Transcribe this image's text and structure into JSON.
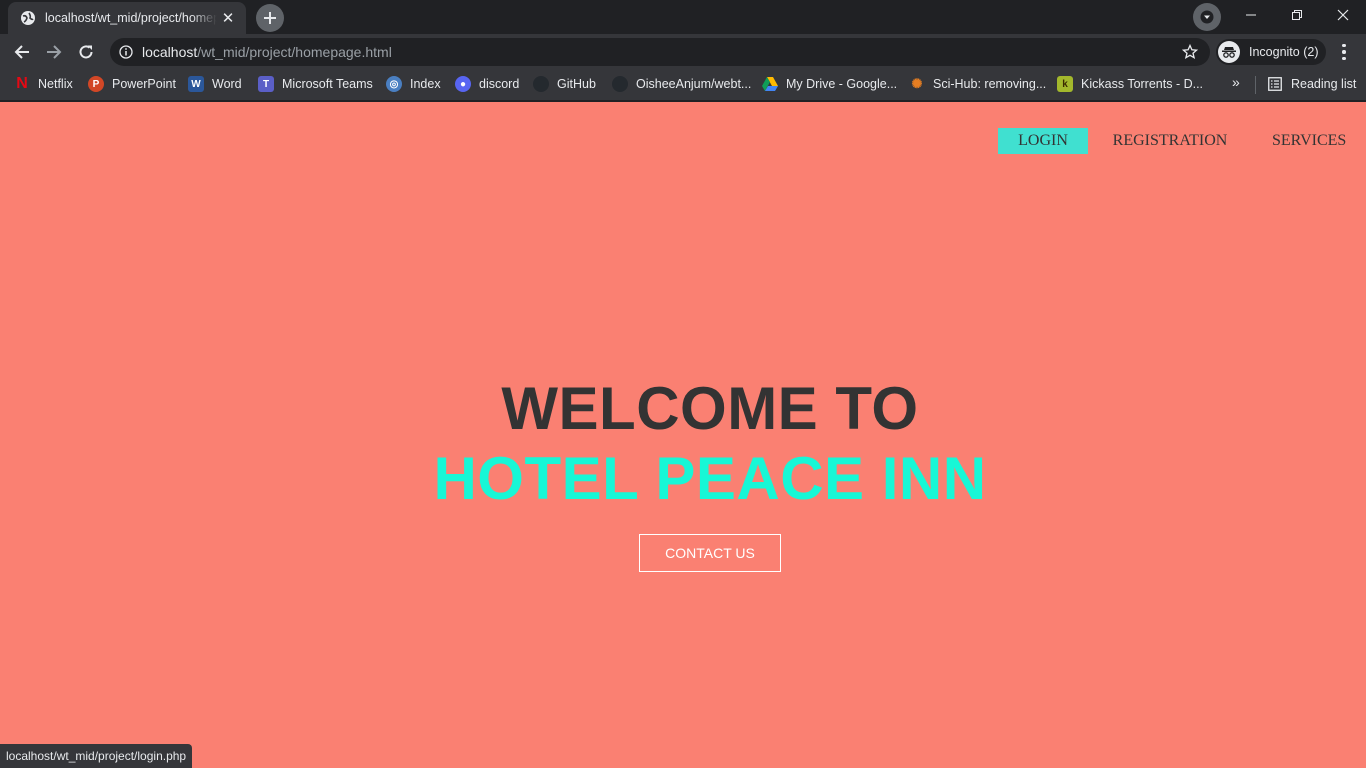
{
  "tab": {
    "title": "localhost/wt_mid/project/homepage.html",
    "favicon": "globe-icon"
  },
  "address_bar": {
    "host": "localhost",
    "path": "/wt_mid/project/homepage.html"
  },
  "incognito": {
    "label": "Incognito (2)"
  },
  "bookmarks": [
    {
      "label": "Netflix",
      "icon": "netflix-icon",
      "color": "#e50914"
    },
    {
      "label": "PowerPoint",
      "icon": "powerpoint-icon",
      "color": "#d24726"
    },
    {
      "label": "Word",
      "icon": "word-icon",
      "color": "#2b579a"
    },
    {
      "label": "Microsoft Teams",
      "icon": "teams-icon",
      "color": "#5b5fc7"
    },
    {
      "label": "Index",
      "icon": "index-icon",
      "color": "#4a7fc1"
    },
    {
      "label": "discord",
      "icon": "discord-icon",
      "color": "#5865f2"
    },
    {
      "label": "GitHub",
      "icon": "github-icon",
      "color": "#24292e"
    },
    {
      "label": "OisheeAnjum/webt...",
      "icon": "github-icon",
      "color": "#24292e"
    },
    {
      "label": "My Drive - Google...",
      "icon": "google-drive-icon",
      "color": "#0f9d58"
    },
    {
      "label": "Sci-Hub: removing...",
      "icon": "scihub-icon",
      "color": "#e67e22"
    },
    {
      "label": "Kickass Torrents - D...",
      "icon": "kickass-icon",
      "color": "#a3b82c"
    }
  ],
  "bookmarks_more": "»",
  "reading_list": "Reading list",
  "nav": {
    "login": "LOGIN",
    "registration": "REGISTRATION",
    "services": "SERVICES"
  },
  "hero": {
    "line1": "WELCOME TO",
    "line2": "HOTEL PEACE INN",
    "button": "CONTACT US"
  },
  "status_url": "localhost/wt_mid/project/login.php",
  "colors": {
    "page_bg": "#fa8072",
    "accent": "#40e0d0",
    "hero_accent": "#17f7d6",
    "heading": "#333333"
  }
}
